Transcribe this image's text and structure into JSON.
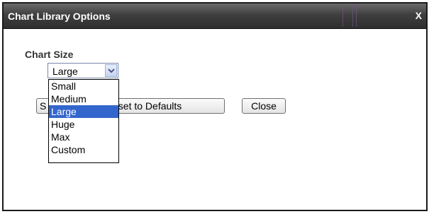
{
  "dialog": {
    "title": "Chart Library Options",
    "close_label": "X"
  },
  "chart_size": {
    "label": "Chart Size",
    "selected": "Large",
    "options": [
      "Small",
      "Medium",
      "Large",
      "Huge",
      "Max",
      "Custom"
    ],
    "highlighted_index": 2
  },
  "buttons": {
    "save_partial": "S",
    "reset_partial": "eset to Defaults",
    "close": "Close"
  },
  "colors": {
    "titlebar": "#3f3f3f",
    "highlight": "#3366cc"
  }
}
